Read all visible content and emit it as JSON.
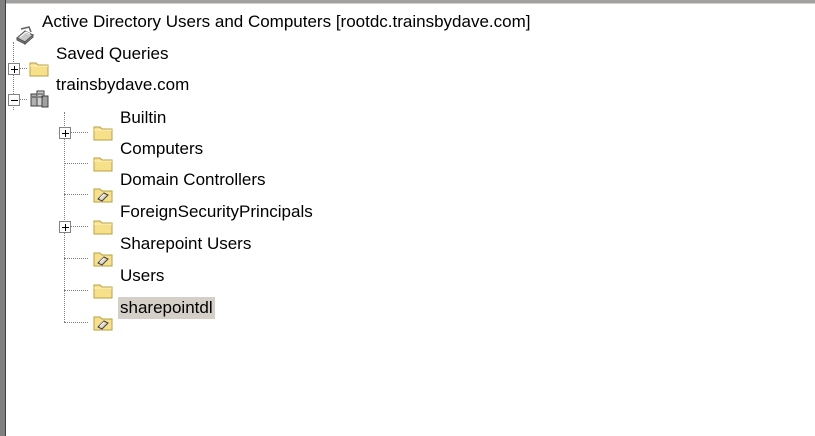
{
  "tree": {
    "root": {
      "label": "Active Directory Users and Computers [rootdc.trainsbydave.com]",
      "icon": "active-directory-icon"
    },
    "saved_queries": {
      "label": "Saved Queries",
      "icon": "folder-icon",
      "expander": "plus"
    },
    "domain": {
      "label": "trainsbydave.com",
      "icon": "domain-icon",
      "expander": "minus",
      "children": [
        {
          "label": "Builtin",
          "icon": "folder-icon",
          "expander": "plus"
        },
        {
          "label": "Computers",
          "icon": "folder-icon",
          "expander": "none"
        },
        {
          "label": "Domain Controllers",
          "icon": "organizational-unit-icon",
          "expander": "none"
        },
        {
          "label": "ForeignSecurityPrincipals",
          "icon": "folder-icon",
          "expander": "plus"
        },
        {
          "label": "Sharepoint Users",
          "icon": "organizational-unit-icon",
          "expander": "none"
        },
        {
          "label": "Users",
          "icon": "folder-icon",
          "expander": "none"
        },
        {
          "label": "sharepointdl",
          "icon": "organizational-unit-icon",
          "expander": "none",
          "selected": true
        }
      ]
    }
  },
  "colors": {
    "selection": "#d4d0c8",
    "folder": "#f7e08a",
    "folder_edge": "#b8a040",
    "connector": "#808080"
  }
}
